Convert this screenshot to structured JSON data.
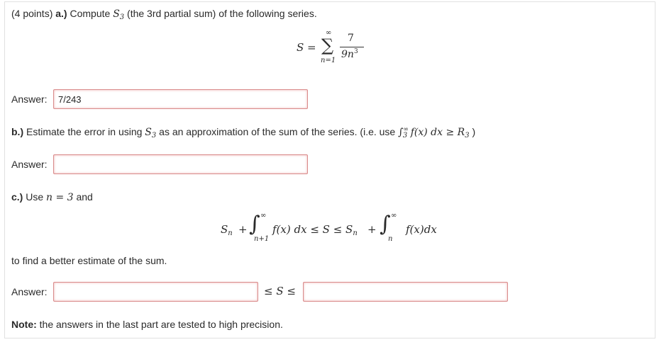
{
  "part_a": {
    "points": "(4 points)",
    "label": "a.)",
    "text_before": "Compute",
    "s_sym": "S",
    "s_sub": "3",
    "text_after": "(the 3rd partial sum) of the following series.",
    "formula": {
      "lhs": "S =",
      "sum_upper": "∞",
      "sum_symbol": "∑",
      "sum_lower": "n=1",
      "numerator": "7",
      "denominator": "9n",
      "denominator_power": "3"
    },
    "answer_label": "Answer:",
    "answer_value": "7/243"
  },
  "part_b": {
    "label": "b.)",
    "text_before": "Estimate the error in using",
    "s_sym": "S",
    "s_sub": "3",
    "text_mid": "as an approximation of the sum of the series. (i.e. use",
    "integral": "∫",
    "int_upper": "∞",
    "int_lower": "3",
    "integrand": "f(x) dx ≥ R",
    "r_sub": "3",
    "close": ")",
    "answer_label": "Answer:",
    "answer_value": ""
  },
  "part_c": {
    "label": "c.)",
    "text_before": "Use",
    "n_eq": "n = 3",
    "text_after": "and",
    "inequality": {
      "s1": "S",
      "s1_sub": "n",
      "plus1": "+",
      "int1": "∫",
      "int1_upper": "∞",
      "int1_lower": "n+1",
      "body1": "f(x) dx ≤ S ≤ S",
      "s2_sub": "n",
      "plus2": "+",
      "int2": "∫",
      "int2_upper": "∞",
      "int2_lower": "n",
      "body2": "f(x)dx"
    },
    "text_to_find": "to find a better estimate of the sum.",
    "answer_label": "Answer:",
    "between": "≤ S ≤",
    "answer_low": "",
    "answer_high": ""
  },
  "note": {
    "label": "Note:",
    "text": "the answers in the last part are tested to high precision."
  }
}
